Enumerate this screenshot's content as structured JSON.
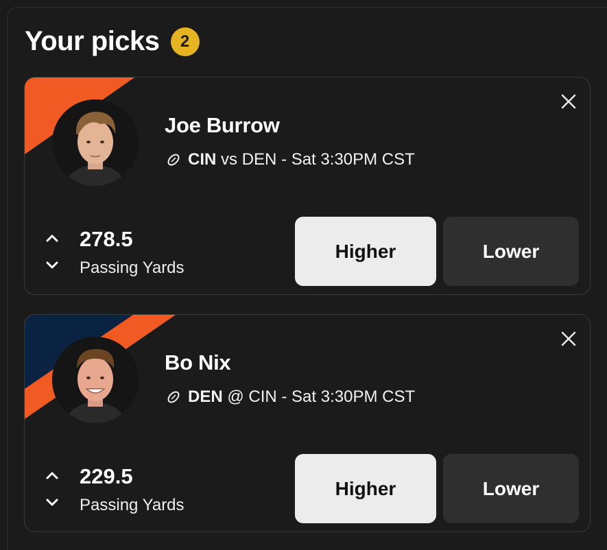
{
  "header": {
    "title": "Your picks",
    "count": "2"
  },
  "picks": [
    {
      "player": "Joe Burrow",
      "team": "CIN",
      "separator": "vs",
      "matchup_rest": "DEN - Sat 3:30PM CST",
      "line": "278.5",
      "stat": "Passing Yards",
      "higher_label": "Higher",
      "lower_label": "Lower",
      "stripe_colors": [
        "#f15a22"
      ],
      "selected": "Higher"
    },
    {
      "player": "Bo Nix",
      "team": "DEN",
      "separator": "@",
      "matchup_rest": "CIN - Sat 3:30PM CST",
      "line": "229.5",
      "stat": "Passing Yards",
      "higher_label": "Higher",
      "lower_label": "Lower",
      "stripe_colors": [
        "#0a2343",
        "#f15a22"
      ],
      "selected": "Higher"
    }
  ],
  "colors": {
    "badge": "#e6b422",
    "background": "#1b1b1b",
    "higher_bg": "#ececec",
    "lower_bg": "#2f2f2f"
  }
}
